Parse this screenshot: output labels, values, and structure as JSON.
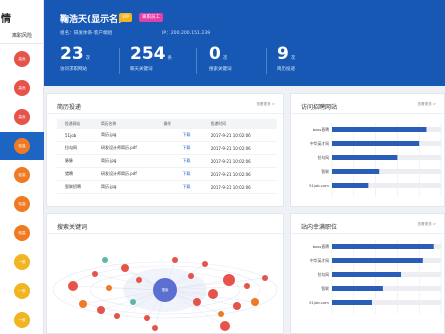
{
  "sidebar": {
    "title": "情",
    "subtitle": "离职风险",
    "items": [
      {
        "label": "高危",
        "color": "red"
      },
      {
        "label": "高危",
        "color": "red"
      },
      {
        "label": "高危",
        "color": "red"
      },
      {
        "label": "较高",
        "color": "orange",
        "active": true
      },
      {
        "label": "较高",
        "color": "orange"
      },
      {
        "label": "较高",
        "color": "orange"
      },
      {
        "label": "较高",
        "color": "orange"
      },
      {
        "label": "一般",
        "color": "yellow"
      },
      {
        "label": "一般",
        "color": "yellow"
      },
      {
        "label": "一般",
        "color": "yellow"
      }
    ]
  },
  "header": {
    "name": "鞠浩天(显示名)",
    "badge_vip": "VIP",
    "badge_staff": "离职员工",
    "meta": "组名：研发体系-客户端组",
    "ip": "IP：200.200.151.239"
  },
  "stats": [
    {
      "value": "23",
      "unit": "次",
      "label": "访问求职网站"
    },
    {
      "value": "254",
      "unit": "条",
      "label": "聊天关键词"
    },
    {
      "value": "0",
      "unit": "次",
      "label": "搜索关键词"
    },
    {
      "value": "9",
      "unit": "次",
      "label": "简历投递"
    }
  ],
  "resume_panel": {
    "title": "简历投递",
    "more": "查看更多 >",
    "columns": [
      "投递网站",
      "简历名称",
      "操作",
      "投递时间"
    ],
    "rows": [
      {
        "site": "51job",
        "file": "简历.jpg",
        "action": "下载",
        "time": "2017-9-21 10:02:06"
      },
      {
        "site": "拉勾网",
        "file": "研发设计师简历.pdf",
        "action": "下载",
        "time": "2017-9-21 10:02:06"
      },
      {
        "site": "脉脉",
        "file": "简历.jpg",
        "action": "下载",
        "time": "2017-9-21 10:02:06"
      },
      {
        "site": "猎聘",
        "file": "研发设计师简历.pdf",
        "action": "下载",
        "time": "2017-9-21 10:02:06"
      },
      {
        "site": "智联招聘",
        "file": "简历.jpg",
        "action": "下载",
        "time": "2017-9-21 10:02:06"
      }
    ]
  },
  "search_panel": {
    "title": "搜索关键词",
    "center_label": "搜索"
  },
  "job_site_panel": {
    "title": "访问招聘网站",
    "more": "查看更多 >"
  },
  "keyword_panel": {
    "title": "站内幸满职位",
    "more": "查看更多 >"
  },
  "chart_data": [
    {
      "type": "bar",
      "title": "访问招聘网站",
      "orientation": "horizontal",
      "categories": [
        "boss直聘",
        "中华英才网",
        "拉勾网",
        "智联",
        "51job.com"
      ],
      "values": [
        26,
        24,
        18,
        13,
        10
      ],
      "xlim": [
        0,
        30
      ]
    },
    {
      "type": "bar",
      "title": "站内幸满职位",
      "orientation": "horizontal",
      "categories": [
        "boss直聘",
        "中华英才网",
        "拉勾网",
        "智联",
        "51job.com"
      ],
      "values": [
        28,
        25,
        19,
        14,
        11
      ],
      "xlim": [
        0,
        30
      ]
    }
  ],
  "colors": {
    "brand": "#1758b4",
    "bar": "#2a5db8",
    "bar_bg": "#eceef1"
  }
}
